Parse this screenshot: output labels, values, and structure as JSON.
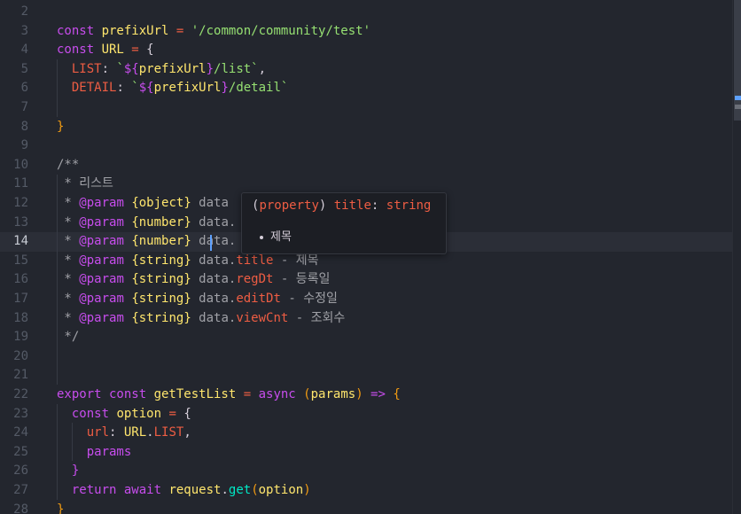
{
  "editor": {
    "current_line": 14,
    "lines": [
      {
        "n": "2",
        "tokens": []
      },
      {
        "n": "3",
        "tokens": [
          [
            "k",
            "const "
          ],
          [
            "v",
            "prefixUrl"
          ],
          [
            "o",
            " = "
          ],
          [
            "s",
            "'/common/community/test'"
          ]
        ]
      },
      {
        "n": "4",
        "tokens": [
          [
            "k",
            "const "
          ],
          [
            "v",
            "URL"
          ],
          [
            "o",
            " = "
          ],
          [
            "br",
            "{"
          ]
        ]
      },
      {
        "n": "5",
        "tokens": [
          [
            "br",
            "  "
          ],
          [
            "pr",
            "LIST"
          ],
          [
            "br",
            ": "
          ],
          [
            "s",
            "`"
          ],
          [
            "k",
            "${"
          ],
          [
            "v",
            "prefixUrl"
          ],
          [
            "k",
            "}"
          ],
          [
            "s",
            "/list`"
          ],
          [
            "br",
            ","
          ]
        ]
      },
      {
        "n": "6",
        "tokens": [
          [
            "br",
            "  "
          ],
          [
            "pr",
            "DETAIL"
          ],
          [
            "br",
            ": "
          ],
          [
            "s",
            "`"
          ],
          [
            "k",
            "${"
          ],
          [
            "v",
            "prefixUrl"
          ],
          [
            "k",
            "}"
          ],
          [
            "s",
            "/detail`"
          ]
        ]
      },
      {
        "n": "7",
        "tokens": []
      },
      {
        "n": "8",
        "tokens": [
          [
            "p",
            "}"
          ]
        ]
      },
      {
        "n": "9",
        "tokens": []
      },
      {
        "n": "10",
        "tokens": [
          [
            "c",
            "/**"
          ]
        ]
      },
      {
        "n": "11",
        "tokens": [
          [
            "c",
            " * 리스트"
          ]
        ]
      },
      {
        "n": "12",
        "tokens": [
          [
            "c",
            " * "
          ],
          [
            "cb",
            "@param "
          ],
          [
            "ct",
            "{object}"
          ],
          [
            "c",
            " data"
          ]
        ]
      },
      {
        "n": "13",
        "tokens": [
          [
            "c",
            " * "
          ],
          [
            "cb",
            "@param "
          ],
          [
            "ct",
            "{number}"
          ],
          [
            "c",
            " data."
          ]
        ]
      },
      {
        "n": "14",
        "tokens": [
          [
            "c",
            " * "
          ],
          [
            "cb",
            "@param "
          ],
          [
            "ct",
            "{number}"
          ],
          [
            "c",
            " data."
          ]
        ]
      },
      {
        "n": "15",
        "tokens": [
          [
            "c",
            " * "
          ],
          [
            "cb",
            "@param "
          ],
          [
            "ct",
            "{string}"
          ],
          [
            "c",
            " data."
          ],
          [
            "o",
            "title"
          ],
          [
            "c",
            " - 제목"
          ]
        ]
      },
      {
        "n": "16",
        "tokens": [
          [
            "c",
            " * "
          ],
          [
            "cb",
            "@param "
          ],
          [
            "ct",
            "{string}"
          ],
          [
            "c",
            " data."
          ],
          [
            "o",
            "regDt"
          ],
          [
            "c",
            " - 등록일"
          ]
        ]
      },
      {
        "n": "17",
        "tokens": [
          [
            "c",
            " * "
          ],
          [
            "cb",
            "@param "
          ],
          [
            "ct",
            "{string}"
          ],
          [
            "c",
            " data."
          ],
          [
            "o",
            "editDt"
          ],
          [
            "c",
            " - 수정일"
          ]
        ]
      },
      {
        "n": "18",
        "tokens": [
          [
            "c",
            " * "
          ],
          [
            "cb",
            "@param "
          ],
          [
            "ct",
            "{string}"
          ],
          [
            "c",
            " data."
          ],
          [
            "o",
            "viewCnt"
          ],
          [
            "c",
            " - 조회수"
          ]
        ]
      },
      {
        "n": "19",
        "tokens": [
          [
            "c",
            " */"
          ]
        ]
      },
      {
        "n": "20",
        "tokens": []
      },
      {
        "n": "21",
        "tokens": []
      },
      {
        "n": "22",
        "tokens": [
          [
            "k",
            "export const "
          ],
          [
            "f",
            "getTestList"
          ],
          [
            "o",
            " = "
          ],
          [
            "k",
            "async "
          ],
          [
            "p",
            "("
          ],
          [
            "v",
            "params"
          ],
          [
            "p",
            ")"
          ],
          [
            "k",
            " => "
          ],
          [
            "p",
            "{"
          ]
        ]
      },
      {
        "n": "23",
        "tokens": [
          [
            "br",
            "  "
          ],
          [
            "k",
            "const "
          ],
          [
            "v",
            "option"
          ],
          [
            "o",
            " = "
          ],
          [
            "br",
            "{"
          ]
        ]
      },
      {
        "n": "24",
        "tokens": [
          [
            "br",
            "    "
          ],
          [
            "pr",
            "url"
          ],
          [
            "br",
            ": "
          ],
          [
            "v",
            "URL"
          ],
          [
            "br",
            "."
          ],
          [
            "pr",
            "LIST"
          ],
          [
            "br",
            ","
          ]
        ]
      },
      {
        "n": "25",
        "tokens": [
          [
            "br",
            "    "
          ],
          [
            "k",
            "params"
          ]
        ]
      },
      {
        "n": "26",
        "tokens": [
          [
            "br",
            "  "
          ],
          [
            "k",
            "}"
          ]
        ]
      },
      {
        "n": "27",
        "tokens": [
          [
            "br",
            "  "
          ],
          [
            "k",
            "return await "
          ],
          [
            "v",
            "request"
          ],
          [
            "br",
            "."
          ],
          [
            "m",
            "get"
          ],
          [
            "p",
            "("
          ],
          [
            "v",
            "option"
          ],
          [
            "p",
            ")"
          ]
        ]
      },
      {
        "n": "28",
        "tokens": [
          [
            "p",
            "}"
          ]
        ]
      }
    ]
  },
  "tooltip": {
    "open_paren": "(",
    "kind": "property",
    "close_paren": ")",
    "name": "title",
    "colon": ":",
    "type": "string",
    "doc": "제목"
  },
  "colors": {
    "background": "#23262e",
    "current_line": "#2b2e37",
    "keyword": "#c74ded",
    "variable": "#ffe66d",
    "string": "#96e072",
    "property": "#ee5d43",
    "comment": "#a0a1a7",
    "cursor": "#5ea1ff"
  }
}
